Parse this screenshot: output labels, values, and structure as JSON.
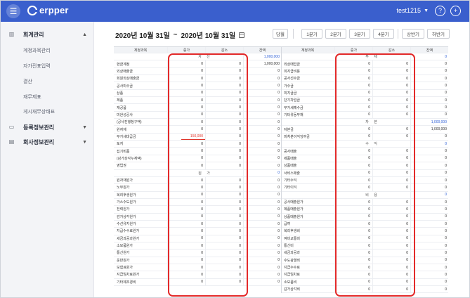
{
  "app": {
    "logo_text": "erpper",
    "user": "test1215",
    "menu_icon": "hamburger-icon",
    "help_icon": "question-icon",
    "add_icon": "plus-icon"
  },
  "sidebar": {
    "sections": [
      {
        "label": "회계관리",
        "icon": "chart-icon",
        "expanded": true
      },
      {
        "label": "등록정보관리",
        "icon": "monitor-icon",
        "expanded": false
      },
      {
        "label": "회사정보관리",
        "icon": "building-icon",
        "expanded": false
      }
    ],
    "items": [
      "계정과목관리",
      "자가전표입력",
      "결산",
      "재무제표",
      "게시재무상태표"
    ]
  },
  "header": {
    "date_from": "2020년 10월 31일",
    "tilde": "~",
    "date_to": "2020년 10월 31일",
    "buttons": [
      "당월",
      "1분기",
      "2분기",
      "3분기",
      "4분기",
      "상반기",
      "하반기"
    ]
  },
  "table": {
    "headers": [
      "계정과목",
      "증가",
      "감소",
      "잔액"
    ],
    "left": [
      {
        "type": "section",
        "label": "자 산",
        "balance": "1,000,000"
      },
      {
        "name": "현금계정",
        "inc": "0",
        "dec": "0",
        "bal": "1,000,000"
      },
      {
        "name": "외상매출금",
        "inc": "0",
        "dec": "0",
        "bal": "0"
      },
      {
        "name": "회원외상매출금",
        "inc": "0",
        "dec": "0",
        "bal": "0"
      },
      {
        "name": "공사미수금",
        "inc": "0",
        "dec": "0",
        "bal": "0"
      },
      {
        "name": "상품",
        "inc": "0",
        "dec": "0",
        "bal": "0"
      },
      {
        "name": "제품",
        "inc": "0",
        "dec": "0",
        "bal": "0"
      },
      {
        "name": "재공품",
        "inc": "0",
        "dec": "0",
        "bal": "0"
      },
      {
        "name": "미완성공사",
        "inc": "0",
        "dec": "0",
        "bal": "0"
      },
      {
        "name": "(공사진행청구액)",
        "inc": "0",
        "dec": "0",
        "bal": "0"
      },
      {
        "name": "원자재",
        "inc": "0",
        "dec": "0",
        "bal": "0"
      },
      {
        "name": "부가세대급금",
        "inc": "150,000",
        "dec": "0",
        "bal": "0",
        "highlight": true
      },
      {
        "name": "토지",
        "inc": "0",
        "dec": "0",
        "bal": "0"
      },
      {
        "name": "집기비품",
        "inc": "0",
        "dec": "0",
        "bal": "0"
      },
      {
        "name": "(감가상각누계액)",
        "inc": "0",
        "dec": "0",
        "bal": "0"
      },
      {
        "name": "영업권",
        "inc": "0",
        "dec": "0",
        "bal": "0"
      },
      {
        "type": "section",
        "label": "원 가",
        "balance": "0"
      },
      {
        "name": "원자재원가",
        "inc": "0",
        "dec": "0",
        "bal": "0"
      },
      {
        "name": "노무원가",
        "inc": "0",
        "dec": "0",
        "bal": "0"
      },
      {
        "name": "복리후생원가",
        "inc": "0",
        "dec": "0",
        "bal": "0"
      },
      {
        "name": "가스수도원가",
        "inc": "0",
        "dec": "0",
        "bal": "0"
      },
      {
        "name": "전력원가",
        "inc": "0",
        "dec": "0",
        "bal": "0"
      },
      {
        "name": "감가상각원가",
        "inc": "0",
        "dec": "0",
        "bal": "0"
      },
      {
        "name": "수선유지원가",
        "inc": "0",
        "dec": "0",
        "bal": "0"
      },
      {
        "name": "지급수수료원가",
        "inc": "0",
        "dec": "0",
        "bal": "0"
      },
      {
        "name": "세금과공과원가",
        "inc": "0",
        "dec": "0",
        "bal": "0"
      },
      {
        "name": "소모품원가",
        "inc": "0",
        "dec": "0",
        "bal": "0"
      },
      {
        "name": "통신원가",
        "inc": "0",
        "dec": "0",
        "bal": "0"
      },
      {
        "name": "운반원가",
        "inc": "0",
        "dec": "0",
        "bal": "0"
      },
      {
        "name": "보험료원가",
        "inc": "0",
        "dec": "0",
        "bal": "0"
      },
      {
        "name": "지급임차료원가",
        "inc": "0",
        "dec": "0",
        "bal": "0"
      },
      {
        "name": "기타제조경비",
        "inc": "0",
        "dec": "0",
        "bal": "0"
      }
    ],
    "right": [
      {
        "type": "section",
        "label": "부 채",
        "balance": "0"
      },
      {
        "name": "외상매입금",
        "inc": "0",
        "dec": "0",
        "bal": "0"
      },
      {
        "name": "미지급비용",
        "inc": "0",
        "dec": "0",
        "bal": "0"
      },
      {
        "name": "공사선수금",
        "inc": "0",
        "dec": "0",
        "bal": "0"
      },
      {
        "name": "가수금",
        "inc": "0",
        "dec": "0",
        "bal": "0"
      },
      {
        "name": "미지급금",
        "inc": "0",
        "dec": "0",
        "bal": "0"
      },
      {
        "name": "단기차입금",
        "inc": "0",
        "dec": "0",
        "bal": "0"
      },
      {
        "name": "부가세예수금",
        "inc": "0",
        "dec": "0",
        "bal": "0"
      },
      {
        "name": "기타유동부채",
        "inc": "0",
        "dec": "0",
        "bal": "0"
      },
      {
        "type": "section",
        "label": "자 본",
        "balance": "1,000,000"
      },
      {
        "name": "자본금",
        "inc": "0",
        "dec": "0",
        "bal": "1,000,000"
      },
      {
        "name": "미처분이익잉여금",
        "inc": "0",
        "dec": "0",
        "bal": "0"
      },
      {
        "type": "section",
        "label": "수 익",
        "balance": "0"
      },
      {
        "name": "공사매출",
        "inc": "0",
        "dec": "0",
        "bal": "0"
      },
      {
        "name": "제품매출",
        "inc": "0",
        "dec": "0",
        "bal": "0"
      },
      {
        "name": "상품매출",
        "inc": "0",
        "dec": "0",
        "bal": "0"
      },
      {
        "name": "서비스매출",
        "inc": "0",
        "dec": "0",
        "bal": "0"
      },
      {
        "name": "기타수익",
        "inc": "0",
        "dec": "0",
        "bal": "0"
      },
      {
        "name": "기타이익",
        "inc": "0",
        "dec": "0",
        "bal": "0"
      },
      {
        "type": "section",
        "label": "비 용",
        "balance": "0"
      },
      {
        "name": "공사매출원가",
        "inc": "0",
        "dec": "0",
        "bal": "0"
      },
      {
        "name": "제품매출원가",
        "inc": "0",
        "dec": "0",
        "bal": "0"
      },
      {
        "name": "상품매출원가",
        "inc": "0",
        "dec": "0",
        "bal": "0"
      },
      {
        "name": "급여",
        "inc": "0",
        "dec": "0",
        "bal": "0"
      },
      {
        "name": "복리후생비",
        "inc": "0",
        "dec": "0",
        "bal": "0"
      },
      {
        "name": "여비교통비",
        "inc": "0",
        "dec": "0",
        "bal": "0"
      },
      {
        "name": "통신비",
        "inc": "0",
        "dec": "0",
        "bal": "0"
      },
      {
        "name": "세금과공과",
        "inc": "0",
        "dec": "0",
        "bal": "0"
      },
      {
        "name": "수도광열비",
        "inc": "0",
        "dec": "0",
        "bal": "0"
      },
      {
        "name": "지급수수료",
        "inc": "0",
        "dec": "0",
        "bal": "0"
      },
      {
        "name": "지급임차료",
        "inc": "0",
        "dec": "0",
        "bal": "0"
      },
      {
        "name": "소모품비",
        "inc": "0",
        "dec": "0",
        "bal": "0"
      },
      {
        "name": "감가상각비",
        "inc": "0",
        "dec": "0",
        "bal": "0"
      }
    ]
  },
  "colors": {
    "topbar": "#3a5fcd",
    "highlight": "#e32a2a",
    "balance_blue": "#2d5fd6",
    "increase_red": "#e0352b"
  }
}
